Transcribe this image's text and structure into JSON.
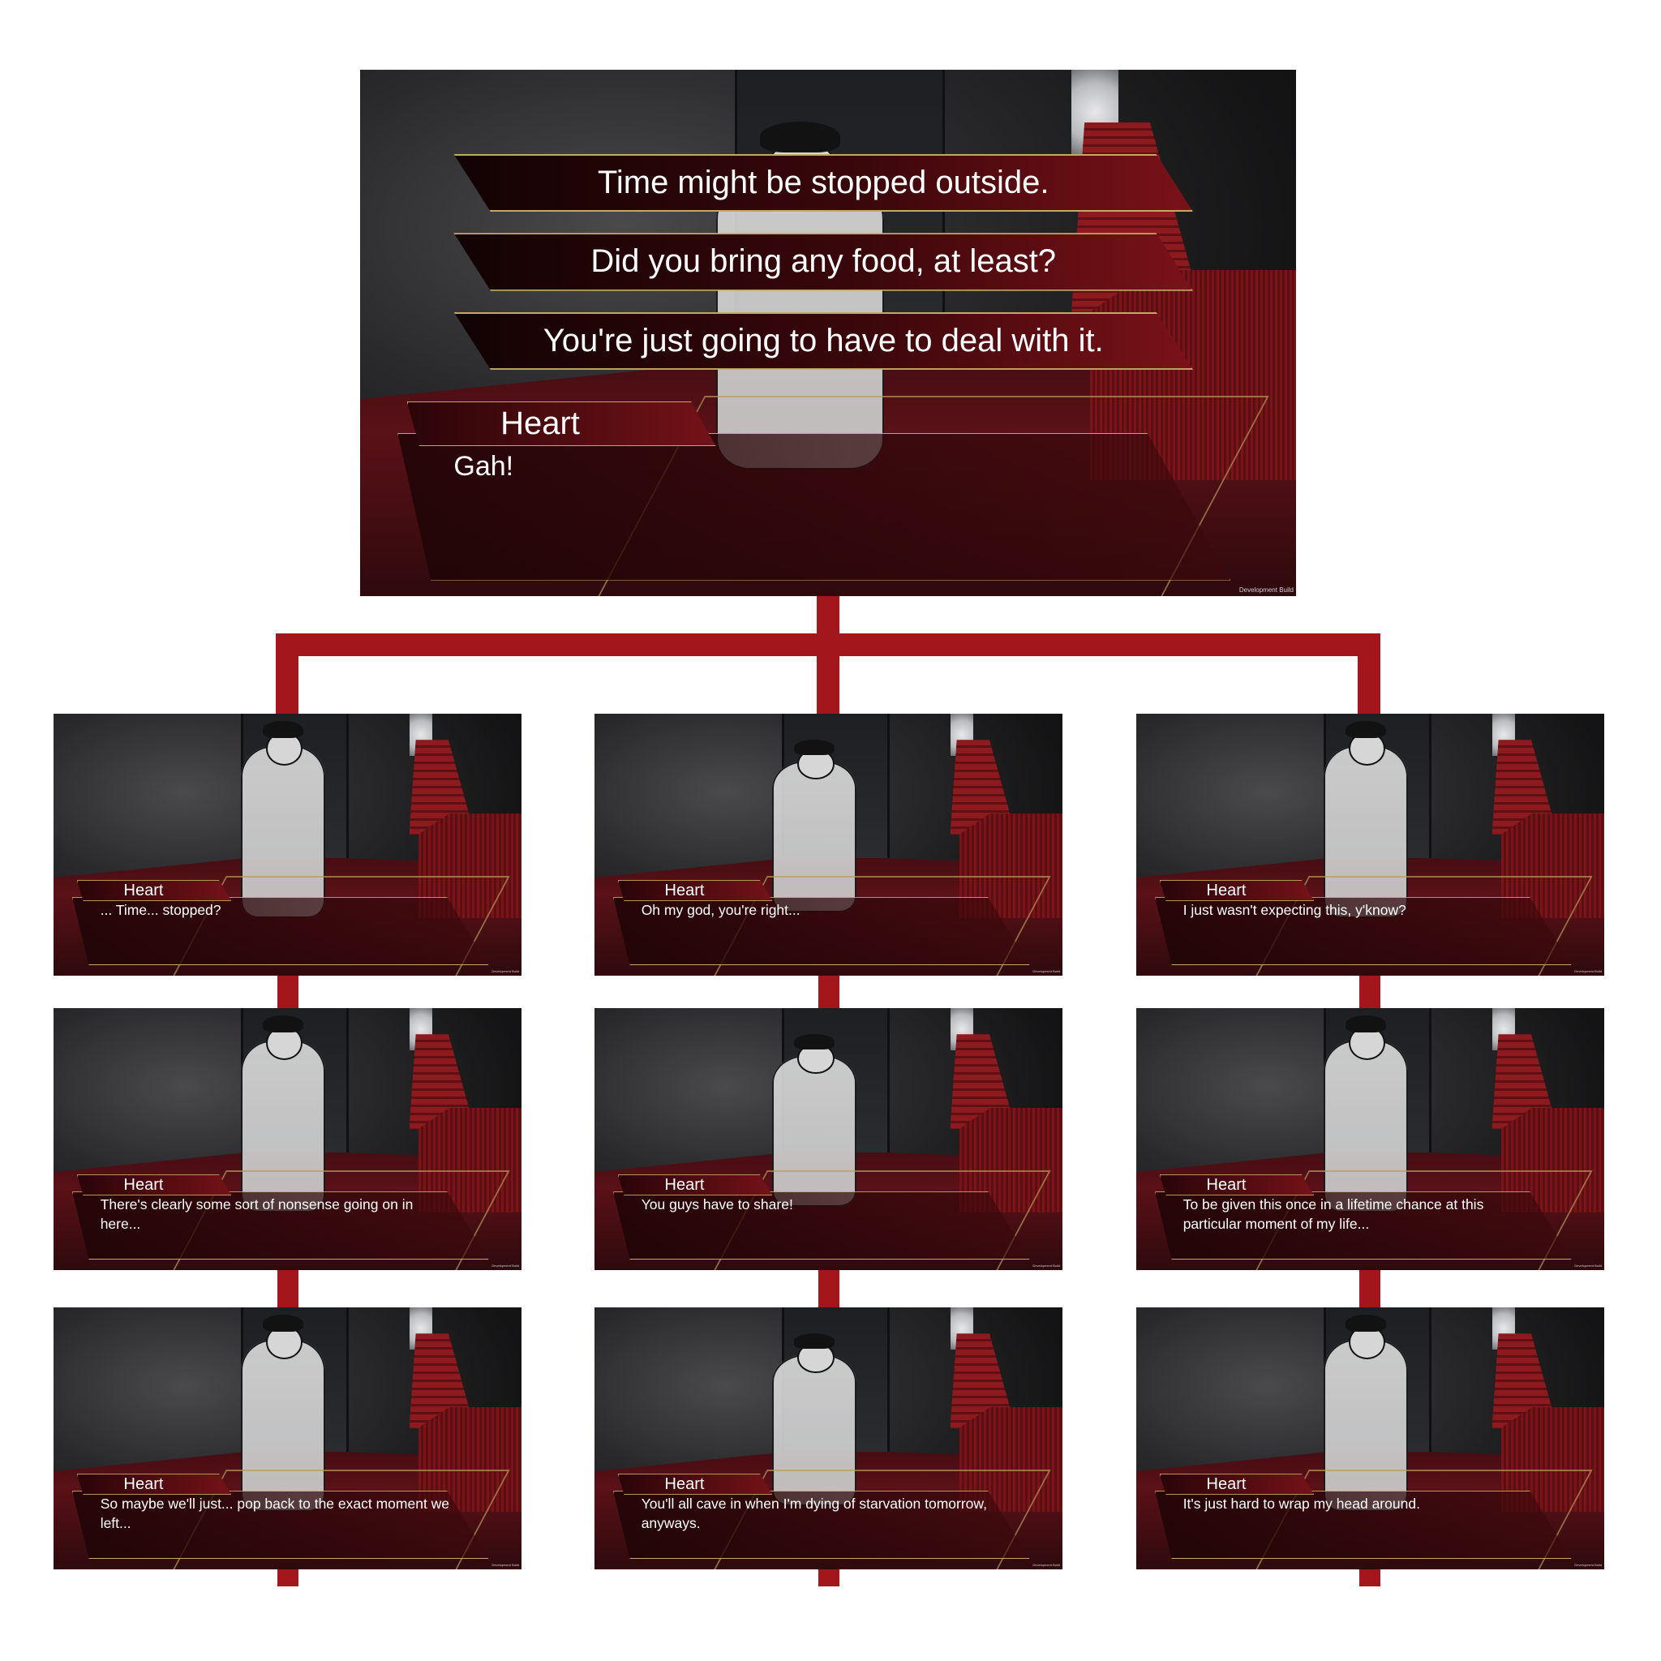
{
  "colors": {
    "accent": "#a3171c",
    "gold": "#c3a86a",
    "text": "#ffffff"
  },
  "main": {
    "choices": [
      "Time might be stopped outside.",
      "Did you bring any food, at least?",
      "You're just going to have to deal with it."
    ],
    "speaker": "Heart",
    "line": "Gah!",
    "watermark": "Development Build"
  },
  "branches": [
    {
      "frames": [
        {
          "speaker": "Heart",
          "line": "... Time... stopped?",
          "watermark": "Development Build"
        },
        {
          "speaker": "Heart",
          "line": "There's clearly some sort of nonsense going on in here...",
          "watermark": "Development Build"
        },
        {
          "speaker": "Heart",
          "line": "So maybe we'll just... pop back to the exact moment we left...",
          "watermark": "Development Build"
        }
      ]
    },
    {
      "frames": [
        {
          "speaker": "Heart",
          "line": "Oh my god, you're right...",
          "watermark": "Development Build"
        },
        {
          "speaker": "Heart",
          "line": "You guys have to share!",
          "watermark": "Development Build"
        },
        {
          "speaker": "Heart",
          "line": "You'll all cave in when I'm dying of starvation tomorrow, anyways.",
          "watermark": "Development Build"
        }
      ]
    },
    {
      "frames": [
        {
          "speaker": "Heart",
          "line": "I just wasn't expecting this, y'know?",
          "watermark": "Development Build"
        },
        {
          "speaker": "Heart",
          "line": "To be given this once in a lifetime chance at this particular moment of my life...",
          "watermark": "Development Build"
        },
        {
          "speaker": "Heart",
          "line": "It's just hard to wrap my head around.",
          "watermark": "Development Build"
        }
      ]
    }
  ]
}
